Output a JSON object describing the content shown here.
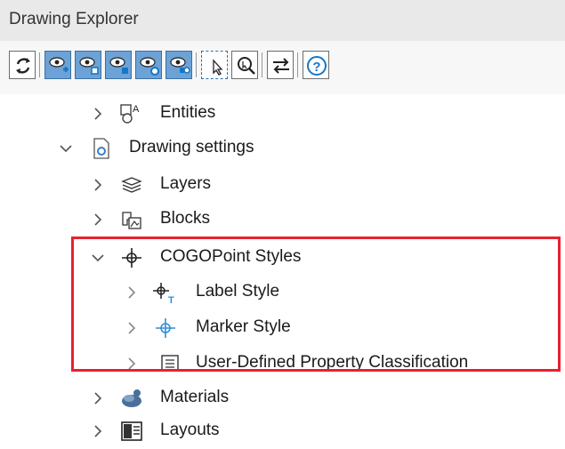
{
  "panel": {
    "title": "Drawing Explorer"
  },
  "tree": {
    "entities": "Entities",
    "drawing_settings": "Drawing settings",
    "layers": "Layers",
    "blocks": "Blocks",
    "cogopoint_styles": "COGOPoint Styles",
    "label_style": "Label Style",
    "marker_style": "Marker Style",
    "udp_classification": "User-Defined Property Classification",
    "materials": "Materials",
    "layouts": "Layouts"
  },
  "colors": {
    "highlight": "#e8212f",
    "toolbar_blue": "#6da2d6",
    "accent_blue": "#2f8fd6"
  }
}
